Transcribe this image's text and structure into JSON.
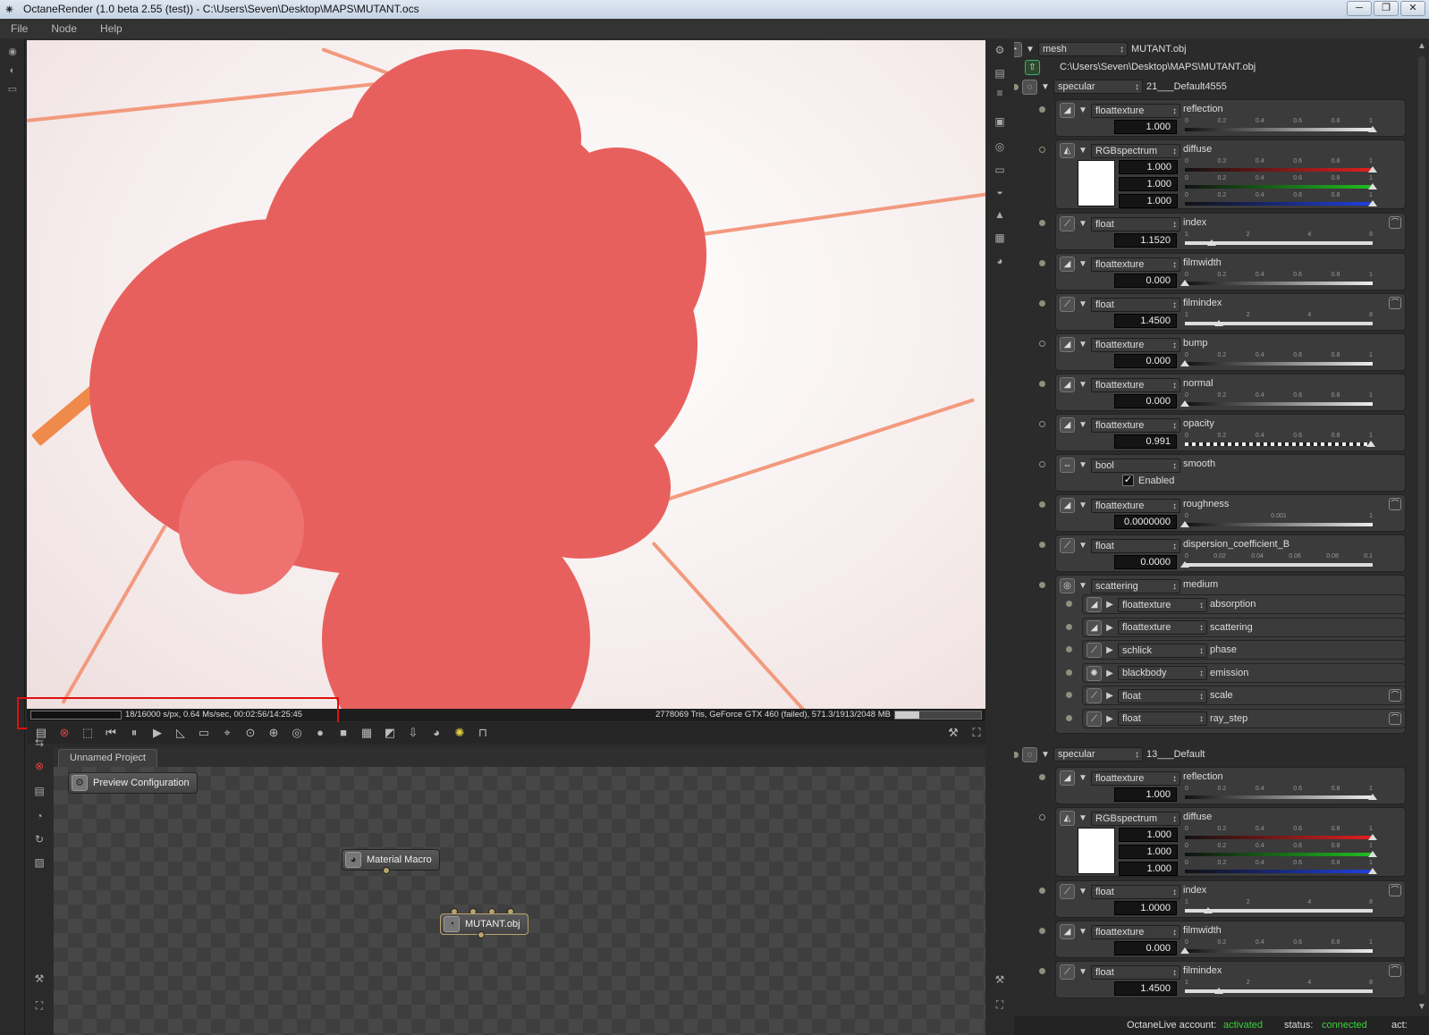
{
  "window": {
    "title": "OctaneRender (1.0 beta 2.55 (test)) - C:\\Users\\Seven\\Desktop\\MAPS\\MUTANT.ocs",
    "min": "─",
    "max": "❐",
    "close": "✕"
  },
  "menu": [
    "File",
    "Node",
    "Help"
  ],
  "render_status": {
    "left": "18/16000 s/px, 0.64 Ms/sec, 00:02:56/14:25:45",
    "right": "2778069 Tris, GeForce GTX 460 (failed), 571.3/1913/2048 MB",
    "memory_used_fraction": 0.28
  },
  "nodegraph": {
    "tab": "Unnamed Project",
    "nodes": {
      "preview": "Preview Configuration",
      "macro": "Material Macro",
      "mesh": "MUTANT.obj"
    }
  },
  "panel": {
    "mesh": {
      "type": "mesh",
      "name": "MUTANT.obj",
      "path": "C:\\Users\\Seven\\Desktop\\MAPS\\MUTANT.obj"
    },
    "mat1": {
      "type": "specular",
      "name": "21___Default4555",
      "reflection": {
        "type": "floattexture",
        "name": "reflection",
        "value": "1.000",
        "level": 1.0
      },
      "diffuse": {
        "type": "RGBspectrum",
        "name": "diffuse",
        "r": "1.000",
        "g": "1.000",
        "b": "1.000"
      },
      "index": {
        "type": "float",
        "name": "index",
        "value": "1.1520",
        "level": 1.152
      },
      "filmwidth": {
        "type": "floattexture",
        "name": "filmwidth",
        "value": "0.000",
        "level": 0
      },
      "filmindex": {
        "type": "float",
        "name": "filmindex",
        "value": "1.4500",
        "level": 1.45
      },
      "bump": {
        "type": "floattexture",
        "name": "bump",
        "value": "0.000",
        "level": 0
      },
      "normal": {
        "type": "floattexture",
        "name": "normal",
        "value": "0.000",
        "level": 0
      },
      "opacity": {
        "type": "floattexture",
        "name": "opacity",
        "value": "0.991",
        "level": 0.991
      },
      "smooth": {
        "type": "bool",
        "name": "smooth",
        "check": "Enabled"
      },
      "roughness": {
        "type": "floattexture",
        "name": "roughness",
        "value": "0.0000000",
        "level": 0
      },
      "dispersion": {
        "type": "float",
        "name": "dispersion_coefficient_B",
        "value": "0.0000",
        "level": 0
      },
      "medium": {
        "type": "scattering",
        "name": "medium",
        "subs": [
          {
            "type": "floattexture",
            "name": "absorption"
          },
          {
            "type": "floattexture",
            "name": "scattering"
          },
          {
            "type": "schlick",
            "name": "phase"
          },
          {
            "type": "blackbody",
            "name": "emission"
          },
          {
            "type": "float",
            "name": "scale"
          },
          {
            "type": "float",
            "name": "ray_step"
          }
        ]
      }
    },
    "mat2": {
      "type": "specular",
      "name": "13___Default",
      "reflection": {
        "type": "floattexture",
        "name": "reflection",
        "value": "1.000",
        "level": 1.0
      },
      "diffuse": {
        "type": "RGBspectrum",
        "name": "diffuse",
        "r": "1.000",
        "g": "1.000",
        "b": "1.000"
      },
      "index": {
        "type": "float",
        "name": "index",
        "value": "1.0000",
        "level": 1.0
      },
      "filmwidth": {
        "type": "floattexture",
        "name": "filmwidth",
        "value": "0.000",
        "level": 0
      },
      "filmindex": {
        "type": "float",
        "name": "filmindex",
        "value": "1.4500",
        "level": 1.45
      }
    },
    "ticks01": [
      "0",
      "0.2",
      "0.4",
      "0.6",
      "0.8",
      "1"
    ],
    "ticks8": [
      "1",
      "2",
      "4",
      "8"
    ],
    "ticksRough": [
      "0",
      "0.001",
      "1"
    ],
    "ticksDisp": [
      "0",
      "0.02",
      "0.04",
      "0.06",
      "0.08",
      "0.1"
    ]
  },
  "status": {
    "account_label": "OctaneLive account:",
    "account_value": "activated",
    "status_label": "status:",
    "status_value": "connected",
    "act_label": "act:"
  }
}
